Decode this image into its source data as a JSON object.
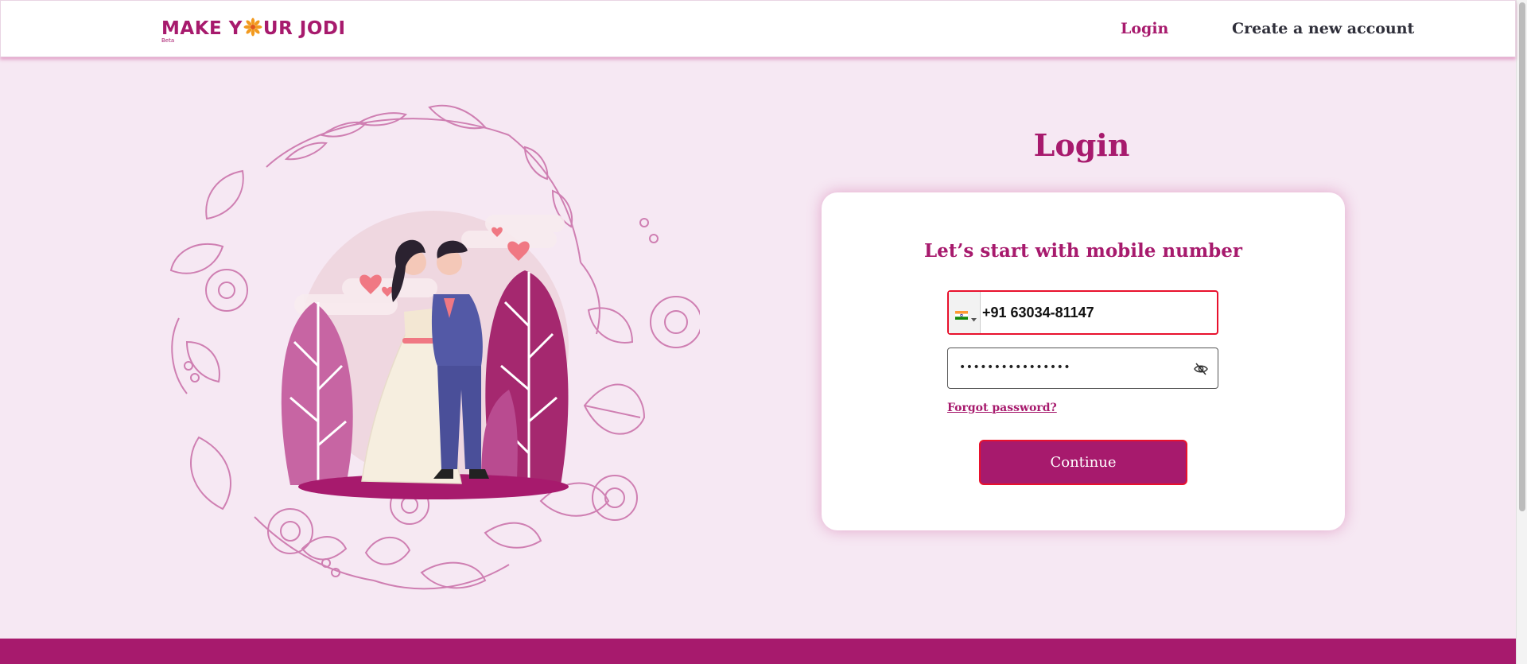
{
  "header": {
    "logo_text_left": "MAKE Y",
    "logo_text_right": "UR JODI",
    "logo_beta": "Beta",
    "nav_login": "Login",
    "nav_create_account": "Create a new account"
  },
  "login": {
    "title": "Login",
    "subtitle": "Let’s start with mobile number",
    "phone_value": "+91 63034-81147",
    "password_value": "••••••••••••••••",
    "forgot_password": "Forgot password?",
    "continue_label": "Continue"
  },
  "colors": {
    "brand": "#a71a6d",
    "page_background": "#f6e8f3",
    "error_border": "#e8112d"
  },
  "icons": {
    "country_flag": "india-flag-icon",
    "password_toggle": "eye-off-icon"
  }
}
